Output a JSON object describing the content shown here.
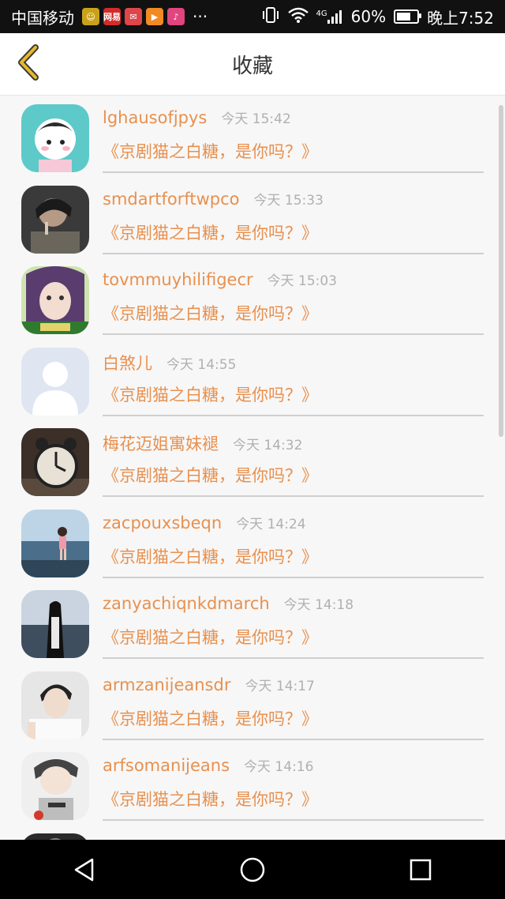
{
  "status": {
    "carrier": "中国移动",
    "dots": "···",
    "network": "4G",
    "battery": "60%",
    "time": "晚上7:52",
    "app_icons": [
      {
        "name": "smile-app-icon",
        "color": "#c9a21c",
        "text": "☺"
      },
      {
        "name": "netease-app-icon",
        "color": "#d32b2b",
        "text": "网易"
      },
      {
        "name": "mail-app-icon",
        "color": "#e0454a",
        "text": "✉"
      },
      {
        "name": "video-app-icon",
        "color": "#f08a24",
        "text": "▶"
      },
      {
        "name": "music-app-icon",
        "color": "#e0457d",
        "text": "♪"
      }
    ]
  },
  "header": {
    "title": "收藏"
  },
  "colors": {
    "accent": "#e8904e",
    "back_arrow": "#e6b92a",
    "time": "#b0b0b0"
  },
  "items": [
    {
      "name": "lghausofjpys",
      "time": "今天 15:42",
      "title": "《京剧猫之白糖，是你吗？》",
      "avatar": "cartoon"
    },
    {
      "name": "smdartforftwpco",
      "time": "今天 15:33",
      "title": "《京剧猫之白糖，是你吗？》",
      "avatar": "dark-portrait"
    },
    {
      "name": "tovmmuyhilifigecr",
      "time": "今天 15:03",
      "title": "《京剧猫之白糖，是你吗？》",
      "avatar": "girl-purple"
    },
    {
      "name": "白煞儿",
      "time": "今天 14:55",
      "title": "《京剧猫之白糖，是你吗？》",
      "avatar": "default"
    },
    {
      "name": "梅花迈姐寓妹褪",
      "time": "今天 14:32",
      "title": "《京剧猫之白糖，是你吗？》",
      "avatar": "clock"
    },
    {
      "name": "zacpouxsbeqn",
      "time": "今天 14:24",
      "title": "《京剧猫之白糖，是你吗？》",
      "avatar": "beach"
    },
    {
      "name": "zanyachiqnkdmarch",
      "time": "今天 14:18",
      "title": "《京剧猫之白糖，是你吗？》",
      "avatar": "sea-girl"
    },
    {
      "name": "armzanijeansdr",
      "time": "今天 14:17",
      "title": "《京剧猫之白糖，是你吗？》",
      "avatar": "boy-white"
    },
    {
      "name": "arfsomanijeans",
      "time": "今天 14:16",
      "title": "《京剧猫之白糖，是你吗？》",
      "avatar": "boy-sketch"
    }
  ],
  "nav": {
    "back": "back-triangle-icon",
    "home": "home-circle-icon",
    "recent": "recent-square-icon"
  }
}
